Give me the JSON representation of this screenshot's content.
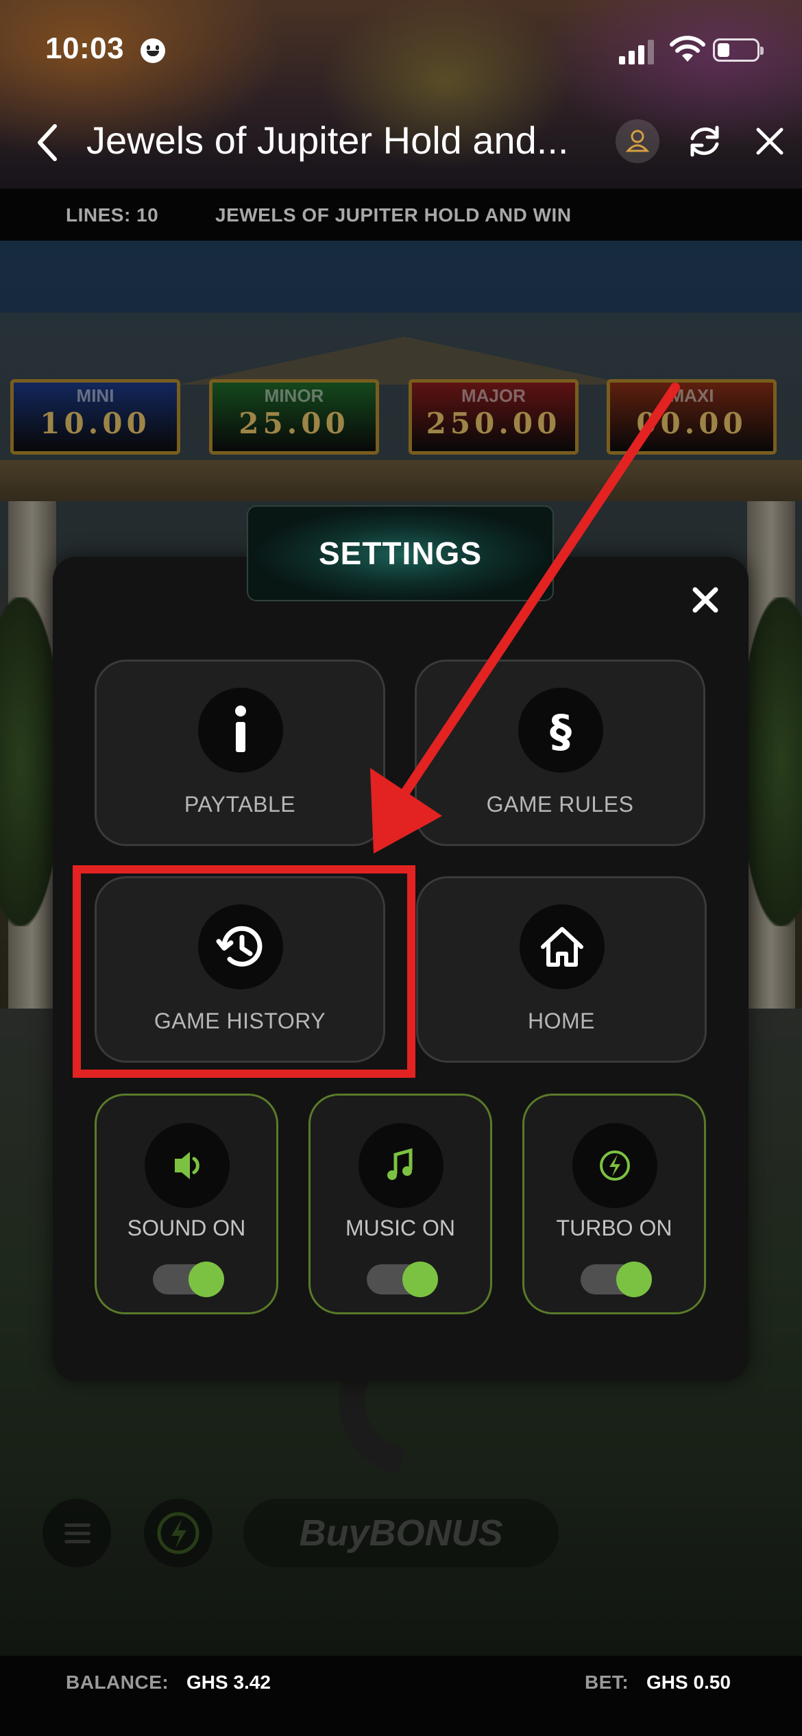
{
  "status_bar": {
    "time": "10:03"
  },
  "nav": {
    "title": "Jewels of Jupiter Hold and..."
  },
  "info_bar": {
    "lines": "LINES: 10",
    "game_name": "JEWELS OF JUPITER HOLD AND WIN"
  },
  "jackpots": [
    {
      "name": "MINI",
      "value": "10.00",
      "color": "#1c3a8a"
    },
    {
      "name": "MINOR",
      "value": "25.00",
      "color": "#1f6a2a"
    },
    {
      "name": "MAJOR",
      "value": "250.00",
      "color": "#8a1c1c"
    },
    {
      "name": "MAXI",
      "value": "00.00",
      "color": "#8a2f16"
    }
  ],
  "game": {
    "buy_bonus": "BuyBONUS"
  },
  "settings": {
    "title": "SETTINGS",
    "tiles": [
      {
        "label": "PAYTABLE",
        "icon": "info-icon"
      },
      {
        "label": "GAME RULES",
        "icon": "section-icon"
      },
      {
        "label": "GAME HISTORY",
        "icon": "history-icon"
      },
      {
        "label": "HOME",
        "icon": "home-icon"
      }
    ],
    "toggles": [
      {
        "label": "SOUND ON",
        "icon": "speaker-icon",
        "on": true
      },
      {
        "label": "MUSIC ON",
        "icon": "music-note-icon",
        "on": true
      },
      {
        "label": "TURBO ON",
        "icon": "lightning-icon",
        "on": true
      }
    ],
    "accent_color": "#7cc242"
  },
  "annotation": {
    "color": "#e32222"
  },
  "bottom_bar": {
    "balance_label": "BALANCE:",
    "balance_value": "GHS 3.42",
    "bet_label": "BET:",
    "bet_value": "GHS 0.50"
  }
}
